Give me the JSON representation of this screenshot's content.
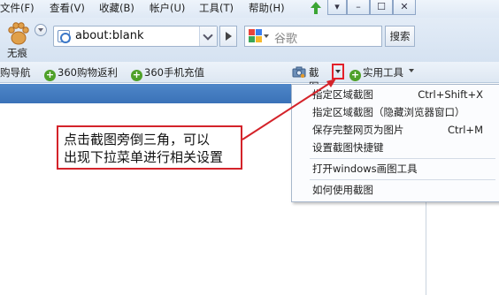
{
  "menubar": {
    "items": [
      "文件(F)",
      "查看(V)",
      "收藏(B)",
      "帐户(U)",
      "工具(T)",
      "帮助(H)"
    ],
    "window_controls": [
      "▾",
      "–",
      "☐",
      "✕"
    ]
  },
  "toolbar": {
    "incognito_label": "无痕",
    "address_value": "about:blank",
    "search_placeholder": "谷歌",
    "search_button": "搜索"
  },
  "favorites": {
    "items": [
      "购导航",
      "360购物返利",
      "360手机充值"
    ],
    "screenshot_label": "截图",
    "tools_label": "实用工具"
  },
  "menu": {
    "items": [
      {
        "label": "指定区域截图",
        "shortcut": "Ctrl+Shift+X"
      },
      {
        "label": "指定区域截图（隐藏浏览器窗口）",
        "shortcut": ""
      },
      {
        "label": "保存完整网页为图片",
        "shortcut": "Ctrl+M"
      },
      {
        "label": "设置截图快捷键",
        "shortcut": ""
      },
      {
        "label": "打开windows画图工具",
        "shortcut": ""
      },
      {
        "label": "如何使用截图",
        "shortcut": ""
      }
    ]
  },
  "annotation": {
    "line1": "点击截图旁倒三角，可以",
    "line2": "出现下拉菜单进行相关设置"
  },
  "colors": {
    "annotation_red": "#d4232a",
    "tab_blue": "#3a72b8",
    "plus_green": "#4fa12a"
  }
}
